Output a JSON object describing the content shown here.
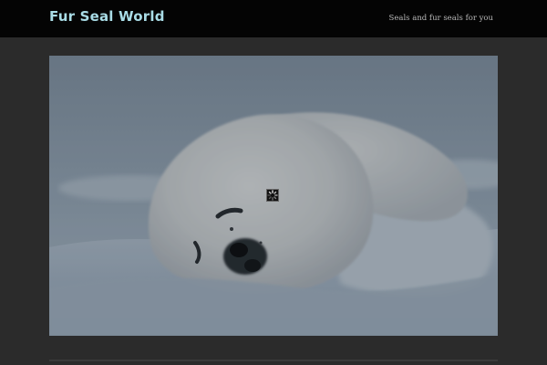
{
  "site": {
    "title": "Fur Seal World",
    "tagline": "Seals and fur seals for you"
  },
  "photo": {
    "alt": "",
    "loading": true
  },
  "colors": {
    "header_bg": "#040404",
    "page_bg": "#2b2b2b",
    "title": "#a9dce6",
    "tagline": "#b8b8b8"
  },
  "icons": {
    "spinner": "loading-spinner-icon"
  }
}
